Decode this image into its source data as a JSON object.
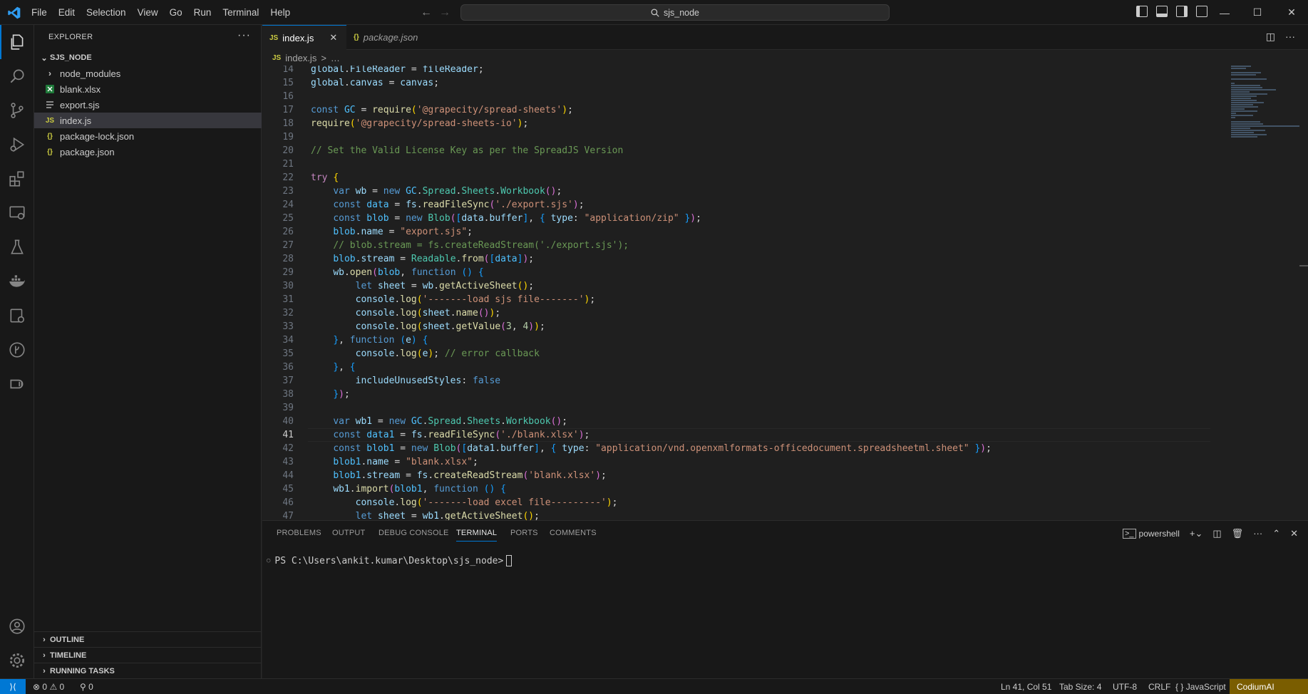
{
  "menu": [
    "File",
    "Edit",
    "Selection",
    "View",
    "Go",
    "Run",
    "Terminal",
    "Help"
  ],
  "search": {
    "text": "sjs_node"
  },
  "sidebar": {
    "title": "EXPLORER",
    "more": "···",
    "folder": "SJS_NODE",
    "items": [
      {
        "label": "node_modules",
        "icon": "chevron-right-icon"
      },
      {
        "label": "blank.xlsx",
        "icon": "excel-file-icon"
      },
      {
        "label": "export.sjs",
        "icon": "lines-file-icon"
      },
      {
        "label": "index.js",
        "icon": "js-file-icon",
        "selected": true
      },
      {
        "label": "package-lock.json",
        "icon": "json-file-icon"
      },
      {
        "label": "package.json",
        "icon": "json-file-icon"
      }
    ],
    "sections": [
      "OUTLINE",
      "TIMELINE",
      "RUNNING TASKS"
    ]
  },
  "tabs": [
    {
      "label": "index.js",
      "icon": "JS"
    },
    {
      "label": "package.json",
      "icon": "{}"
    }
  ],
  "breadcrumb": {
    "file": "index.js",
    "rest": "…",
    "sep": ">"
  },
  "code": {
    "current_line": 41,
    "lines": [
      {
        "n": 14,
        "html": "<span class=\"var\">global</span><span class=\"pl\">.</span><span class=\"var\">FileReader</span><span class=\"pl\"> = </span><span class=\"var\">fileReader</span><span class=\"pl\">;</span>"
      },
      {
        "n": 15,
        "html": "<span class=\"var\">global</span><span class=\"pl\">.</span><span class=\"var\">canvas</span><span class=\"pl\"> = </span><span class=\"var\">canvas</span><span class=\"pl\">;</span>"
      },
      {
        "n": 16,
        "html": ""
      },
      {
        "n": 17,
        "html": "<span class=\"kw\">const</span><span class=\"pl\"> </span><span class=\"cst\">GC</span><span class=\"pl\"> = </span><span class=\"fn\">require</span><span class=\"br1\">(</span><span class=\"str\">'@grapecity/spread-sheets'</span><span class=\"br1\">)</span><span class=\"pl\">;</span>"
      },
      {
        "n": 18,
        "html": "<span class=\"fn\">require</span><span class=\"br1\">(</span><span class=\"str\">'@grapecity/spread-sheets-io'</span><span class=\"br1\">)</span><span class=\"pl\">;</span>"
      },
      {
        "n": 19,
        "html": ""
      },
      {
        "n": 20,
        "html": "<span class=\"cm\">// Set the Valid License Key as per the SpreadJS Version</span>"
      },
      {
        "n": 21,
        "html": ""
      },
      {
        "n": 22,
        "html": "<span class=\"ctl\">try</span><span class=\"pl\"> </span><span class=\"br1\">{</span>"
      },
      {
        "n": 23,
        "html": "    <span class=\"kw\">var</span><span class=\"pl\"> </span><span class=\"var\">wb</span><span class=\"pl\"> = </span><span class=\"kw\">new</span><span class=\"pl\"> </span><span class=\"cst\">GC</span><span class=\"pl\">.</span><span class=\"cls\">Spread</span><span class=\"pl\">.</span><span class=\"cls\">Sheets</span><span class=\"pl\">.</span><span class=\"cls\">Workbook</span><span class=\"br2\">()</span><span class=\"pl\">;</span>"
      },
      {
        "n": 24,
        "html": "    <span class=\"kw\">const</span><span class=\"pl\"> </span><span class=\"cst\">data</span><span class=\"pl\"> = </span><span class=\"var\">fs</span><span class=\"pl\">.</span><span class=\"fn\">readFileSync</span><span class=\"br2\">(</span><span class=\"str\">'./export.sjs'</span><span class=\"br2\">)</span><span class=\"pl\">;</span>"
      },
      {
        "n": 25,
        "html": "    <span class=\"kw\">const</span><span class=\"pl\"> </span><span class=\"cst\">blob</span><span class=\"pl\"> = </span><span class=\"kw\">new</span><span class=\"pl\"> </span><span class=\"cls\">Blob</span><span class=\"br2\">(</span><span class=\"br3\">[</span><span class=\"var\">data</span><span class=\"pl\">.</span><span class=\"var\">buffer</span><span class=\"br3\">]</span><span class=\"pl\">, </span><span class=\"br3\">{</span><span class=\"pl\"> </span><span class=\"var\">type</span><span class=\"pl\">: </span><span class=\"str\">\"application/zip\"</span><span class=\"pl\"> </span><span class=\"br3\">}</span><span class=\"br2\">)</span><span class=\"pl\">;</span>"
      },
      {
        "n": 26,
        "html": "    <span class=\"cst\">blob</span><span class=\"pl\">.</span><span class=\"var\">name</span><span class=\"pl\"> = </span><span class=\"str\">\"export.sjs\"</span><span class=\"pl\">;</span>"
      },
      {
        "n": 27,
        "html": "    <span class=\"cm\">// blob.stream = fs.createReadStream('./export.sjs');</span>"
      },
      {
        "n": 28,
        "html": "    <span class=\"cst\">blob</span><span class=\"pl\">.</span><span class=\"var\">stream</span><span class=\"pl\"> = </span><span class=\"cls\">Readable</span><span class=\"pl\">.</span><span class=\"fn\">from</span><span class=\"br2\">(</span><span class=\"br3\">[</span><span class=\"cst\">data</span><span class=\"br3\">]</span><span class=\"br2\">)</span><span class=\"pl\">;</span>"
      },
      {
        "n": 29,
        "html": "    <span class=\"var\">wb</span><span class=\"pl\">.</span><span class=\"fn\">open</span><span class=\"br2\">(</span><span class=\"cst\">blob</span><span class=\"pl\">, </span><span class=\"kw\">function</span><span class=\"pl\"> </span><span class=\"br3\">()</span><span class=\"pl\"> </span><span class=\"br3\">{</span>"
      },
      {
        "n": 30,
        "html": "        <span class=\"kw\">let</span><span class=\"pl\"> </span><span class=\"var\">sheet</span><span class=\"pl\"> = </span><span class=\"var\">wb</span><span class=\"pl\">.</span><span class=\"fn\">getActiveSheet</span><span class=\"br1\">()</span><span class=\"pl\">;</span>"
      },
      {
        "n": 31,
        "html": "        <span class=\"var\">console</span><span class=\"pl\">.</span><span class=\"fn\">log</span><span class=\"br1\">(</span><span class=\"str\">'-------load sjs file-------'</span><span class=\"br1\">)</span><span class=\"pl\">;</span>"
      },
      {
        "n": 32,
        "html": "        <span class=\"var\">console</span><span class=\"pl\">.</span><span class=\"fn\">log</span><span class=\"br1\">(</span><span class=\"var\">sheet</span><span class=\"pl\">.</span><span class=\"fn\">name</span><span class=\"br2\">()</span><span class=\"br1\">)</span><span class=\"pl\">;</span>"
      },
      {
        "n": 33,
        "html": "        <span class=\"var\">console</span><span class=\"pl\">.</span><span class=\"fn\">log</span><span class=\"br1\">(</span><span class=\"var\">sheet</span><span class=\"pl\">.</span><span class=\"fn\">getValue</span><span class=\"br2\">(</span><span class=\"num\">3</span><span class=\"pl\">, </span><span class=\"num\">4</span><span class=\"br2\">)</span><span class=\"br1\">)</span><span class=\"pl\">;</span>"
      },
      {
        "n": 34,
        "html": "    <span class=\"br3\">}</span><span class=\"pl\">, </span><span class=\"kw\">function</span><span class=\"pl\"> </span><span class=\"br3\">(</span><span class=\"var\">e</span><span class=\"br3\">)</span><span class=\"pl\"> </span><span class=\"br3\">{</span>"
      },
      {
        "n": 35,
        "html": "        <span class=\"var\">console</span><span class=\"pl\">.</span><span class=\"fn\">log</span><span class=\"br1\">(</span><span class=\"var\">e</span><span class=\"br1\">)</span><span class=\"pl\">; </span><span class=\"cm\">// error callback</span>"
      },
      {
        "n": 36,
        "html": "    <span class=\"br3\">}</span><span class=\"pl\">, </span><span class=\"br3\">{</span>"
      },
      {
        "n": 37,
        "html": "        <span class=\"var\">includeUnusedStyles</span><span class=\"pl\">: </span><span class=\"kw\">false</span>"
      },
      {
        "n": 38,
        "html": "    <span class=\"br3\">}</span><span class=\"br2\">)</span><span class=\"pl\">;</span>"
      },
      {
        "n": 39,
        "html": ""
      },
      {
        "n": 40,
        "html": "    <span class=\"kw\">var</span><span class=\"pl\"> </span><span class=\"var\">wb1</span><span class=\"pl\"> = </span><span class=\"kw\">new</span><span class=\"pl\"> </span><span class=\"cst\">GC</span><span class=\"pl\">.</span><span class=\"cls\">Spread</span><span class=\"pl\">.</span><span class=\"cls\">Sheets</span><span class=\"pl\">.</span><span class=\"cls\">Workbook</span><span class=\"br2\">()</span><span class=\"pl\">;</span>"
      },
      {
        "n": 41,
        "html": "    <span class=\"kw\">const</span><span class=\"pl\"> </span><span class=\"cst\">data1</span><span class=\"pl\"> = </span><span class=\"var\">fs</span><span class=\"pl\">.</span><span class=\"fn\">readFileSync</span><span class=\"br2\">(</span><span class=\"str\">'./blank.xlsx'</span><span class=\"br2\">)</span><span class=\"pl\">;</span>"
      },
      {
        "n": 42,
        "html": "    <span class=\"kw\">const</span><span class=\"pl\"> </span><span class=\"cst\">blob1</span><span class=\"pl\"> = </span><span class=\"kw\">new</span><span class=\"pl\"> </span><span class=\"cls\">Blob</span><span class=\"br2\">(</span><span class=\"br3\">[</span><span class=\"var\">data1</span><span class=\"pl\">.</span><span class=\"var\">buffer</span><span class=\"br3\">]</span><span class=\"pl\">, </span><span class=\"br3\">{</span><span class=\"pl\"> </span><span class=\"var\">type</span><span class=\"pl\">: </span><span class=\"str\">\"application/vnd.openxmlformats-officedocument.spreadsheetml.sheet\"</span><span class=\"pl\"> </span><span class=\"br3\">}</span><span class=\"br2\">)</span><span class=\"pl\">;</span>"
      },
      {
        "n": 43,
        "html": "    <span class=\"cst\">blob1</span><span class=\"pl\">.</span><span class=\"var\">name</span><span class=\"pl\"> = </span><span class=\"str\">\"blank.xlsx\"</span><span class=\"pl\">;</span>"
      },
      {
        "n": 44,
        "html": "    <span class=\"cst\">blob1</span><span class=\"pl\">.</span><span class=\"var\">stream</span><span class=\"pl\"> = </span><span class=\"var\">fs</span><span class=\"pl\">.</span><span class=\"fn\">createReadStream</span><span class=\"br2\">(</span><span class=\"str\">'blank.xlsx'</span><span class=\"br2\">)</span><span class=\"pl\">;</span>"
      },
      {
        "n": 45,
        "html": "    <span class=\"var\">wb1</span><span class=\"pl\">.</span><span class=\"fn\">import</span><span class=\"br2\">(</span><span class=\"cst\">blob1</span><span class=\"pl\">, </span><span class=\"kw\">function</span><span class=\"pl\"> </span><span class=\"br3\">()</span><span class=\"pl\"> </span><span class=\"br3\">{</span>"
      },
      {
        "n": 46,
        "html": "        <span class=\"var\">console</span><span class=\"pl\">.</span><span class=\"fn\">log</span><span class=\"br1\">(</span><span class=\"str\">'-------load excel file---------'</span><span class=\"br1\">)</span><span class=\"pl\">;</span>"
      },
      {
        "n": 47,
        "html": "        <span class=\"kw\">let</span><span class=\"pl\"> </span><span class=\"var\">sheet</span><span class=\"pl\"> = </span><span class=\"var\">wb1</span><span class=\"pl\">.</span><span class=\"fn\">getActiveSheet</span><span class=\"br1\">()</span><span class=\"pl\">;</span>"
      }
    ]
  },
  "panel": {
    "tabs": [
      "PROBLEMS",
      "OUTPUT",
      "DEBUG CONSOLE",
      "TERMINAL",
      "PORTS",
      "COMMENTS"
    ],
    "active_tab": "TERMINAL",
    "shell": "powershell",
    "prompt": "PS C:\\Users\\ankit.kumar\\Desktop\\sjs_node>"
  },
  "status": {
    "errors": "0",
    "warnings": "0",
    "ports": "0",
    "position": "Ln 41, Col 51",
    "tab_size": "Tab Size: 4",
    "encoding": "UTF-8",
    "eol": "CRLF",
    "language": "JavaScript",
    "language_icon": "{ }",
    "extension": "CodiumAI"
  },
  "colors": {
    "accent": "#0078d4",
    "bg": "#1f1f1f",
    "chrome": "#181818",
    "codium": "#7a5d00"
  }
}
